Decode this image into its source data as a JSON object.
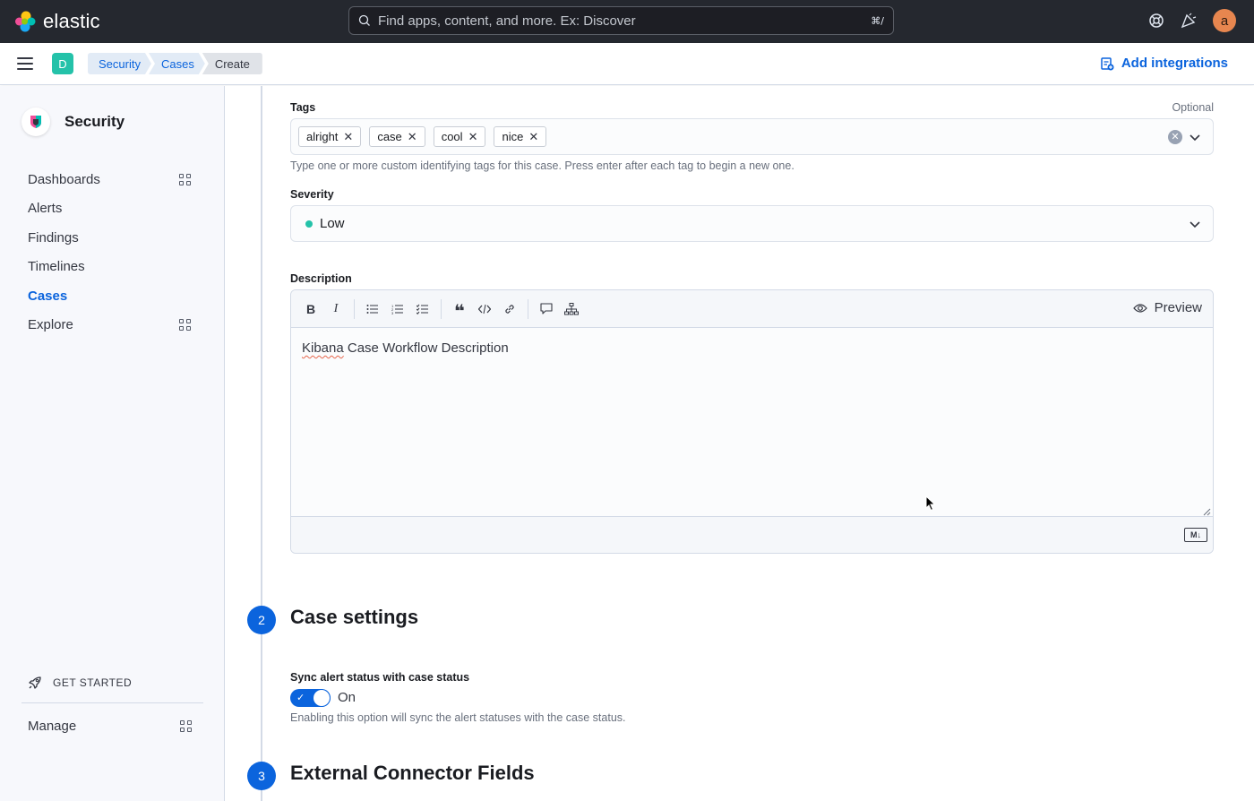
{
  "topbar": {
    "brand": "elastic",
    "search_placeholder": "Find apps, content, and more. Ex: Discover",
    "search_shortcut": "⌘/",
    "avatar_initial": "a",
    "avatar_color": "#e7864f"
  },
  "subbar": {
    "space_initial": "D",
    "breadcrumbs": [
      "Security",
      "Cases",
      "Create"
    ],
    "add_integrations": "Add integrations"
  },
  "sidebar": {
    "title": "Security",
    "items": [
      {
        "label": "Dashboards",
        "icon": "grid-icon"
      },
      {
        "label": "Alerts"
      },
      {
        "label": "Findings"
      },
      {
        "label": "Timelines"
      },
      {
        "label": "Cases",
        "active": true
      },
      {
        "label": "Explore",
        "icon": "grid-icon"
      }
    ],
    "get_started": "GET STARTED",
    "manage": "Manage"
  },
  "form": {
    "tags": {
      "label": "Tags",
      "optional": "Optional",
      "values": [
        "alright",
        "case",
        "cool",
        "nice"
      ],
      "help": "Type one or more custom identifying tags for this case. Press enter after each tag to begin a new one."
    },
    "severity": {
      "label": "Severity",
      "value": "Low",
      "color": "#24c2a9"
    },
    "description": {
      "label": "Description",
      "preview_label": "Preview",
      "text_first_word": "Kibana",
      "text_rest": " Case Workflow Description",
      "markdown_badge": "M↓"
    }
  },
  "steps": [
    {
      "number": "2",
      "title": "Case settings"
    },
    {
      "number": "3",
      "title": "External Connector Fields"
    }
  ],
  "case_settings": {
    "sync_label": "Sync alert status with case status",
    "sync_state": "On",
    "sync_help": "Enabling this option will sync the alert statuses with the case status."
  },
  "colors": {
    "primary": "#0b64dd",
    "topbar_bg": "#25282f",
    "space_badge": "#24c2a9"
  }
}
